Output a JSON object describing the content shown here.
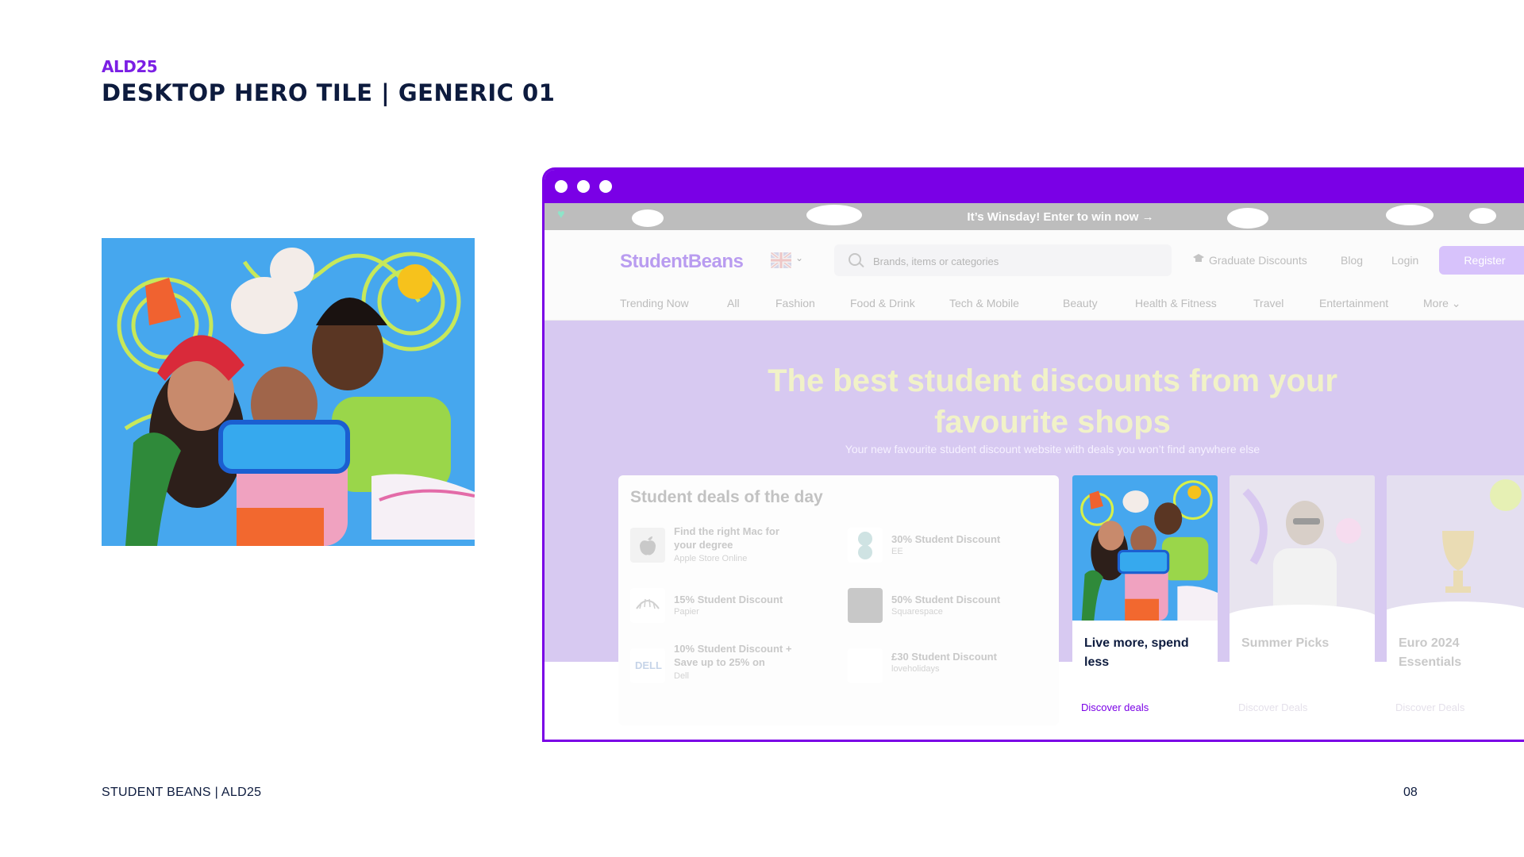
{
  "slide": {
    "kicker": "ALD25",
    "title": "DESKTOP HERO TILE | GENERIC 01",
    "footer_left": "STUDENT BEANS | ALD25",
    "page_number": "08"
  },
  "browser": {
    "accent_color": "#7a00e6",
    "promo_text": "It’s Winsday! Enter to win now →",
    "logo": "StudentBeans",
    "search_placeholder": "Brands, items or categories",
    "top_links": [
      "Graduate Discounts",
      "Blog",
      "Login"
    ],
    "register_label": "Register",
    "categories": [
      "Trending Now",
      "All",
      "Fashion",
      "Food & Drink",
      "Tech & Mobile",
      "Beauty",
      "Health & Fitness",
      "Travel",
      "Entertainment",
      "More ⌄"
    ],
    "hero_title": "The best student discounts from your favourite shops",
    "hero_subtitle": "Your new favourite student discount website with deals you won’t find anywhere else",
    "deals": {
      "heading": "Student deals of the day",
      "items": [
        {
          "title": "Find the right Mac for your degree",
          "brand": "Apple Store Online",
          "logo": ""
        },
        {
          "title": "30% Student Discount",
          "brand": "EE",
          "logo": "EE"
        },
        {
          "title": "15% Student Discount",
          "brand": "Papier",
          "logo": "PAPIER"
        },
        {
          "title": "50% Student Discount",
          "brand": "Squarespace",
          "logo": ""
        },
        {
          "title": "10% Student Discount + Save up to 25% on",
          "brand": "Dell",
          "logo": "DELL"
        },
        {
          "title": "£30 Student Discount",
          "brand": "loveholidays",
          "logo": ""
        }
      ]
    },
    "tiles": [
      {
        "title": "Live more, spend less",
        "link": "Discover deals"
      },
      {
        "title": "Summer Picks",
        "link": "Discover Deals"
      },
      {
        "title": "Euro 2024 Essentials",
        "link": "Discover Deals"
      }
    ]
  }
}
